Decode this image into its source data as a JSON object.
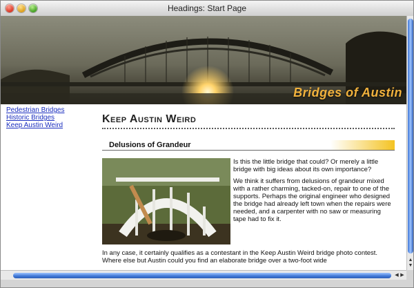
{
  "window": {
    "title": "Headings: Start Page"
  },
  "banner": {
    "title": "Bridges of Austin"
  },
  "sidebar": {
    "links": [
      {
        "label": "Pedestrian Bridges"
      },
      {
        "label": "Historic Bridges"
      },
      {
        "label": "Keep Austin Weird"
      }
    ]
  },
  "main": {
    "heading": "Keep Austin Weird",
    "subheading": "Delusions of Grandeur",
    "para1": "Is this the little bridge that could? Or merely a little bridge with big ideas about its own importance?",
    "para2": "We think it suffers from delusions of grandeur mixed with a rather charming, tacked-on, repair to one of the supports. Perhaps the original engineer who designed the bridge had already left town when the repairs were needed, and a carpenter with no saw or measuring tape had to fix it.",
    "para3": "In any case, it certainly qualifies as a contestant in the Keep Austin Weird bridge photo contest. Where else but Austin could you find an elaborate bridge over a two-foot wide"
  },
  "colors": {
    "link": "#1b2fbf",
    "banner_title": "#f1b23d",
    "accent_gradient": "#f4c322",
    "scroll_thumb": "#3f76d6"
  },
  "icons": {
    "close": "close-icon",
    "minimize": "minimize-icon",
    "maximize": "maximize-icon"
  }
}
